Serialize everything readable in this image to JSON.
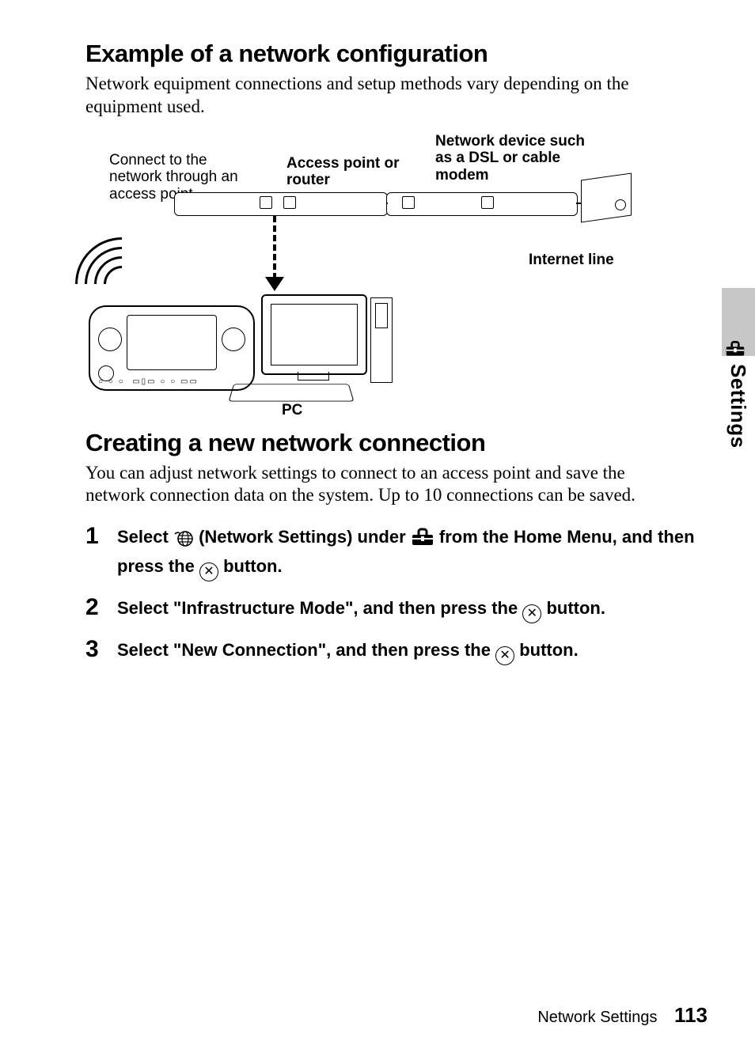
{
  "section1": {
    "heading": "Example of a network configuration",
    "body": "Network equipment connections and setup methods vary depending on the equipment used."
  },
  "diagram": {
    "connect_label": "Connect to the network through an access point.",
    "access_point_label": "Access point or router",
    "modem_label": "Network device such as a DSL or cable modem",
    "internet_label": "Internet line",
    "pc_label": "PC"
  },
  "section2": {
    "heading": "Creating a new network connection",
    "body": "You can adjust network settings to connect to an access point and save the network connection data on the system. Up to 10 connections can be saved."
  },
  "steps": [
    {
      "num": "1",
      "pre": "Select ",
      "net_settings": " (Network Settings) under ",
      "post": " from the Home Menu, and then press the ",
      "tail": " button."
    },
    {
      "num": "2",
      "pre": "Select \"Infrastructure Mode\", and then press the ",
      "tail": " button."
    },
    {
      "num": "3",
      "pre": "Select \"New Connection\", and then press the ",
      "tail": " button."
    }
  ],
  "side": {
    "label": "Settings"
  },
  "footer": {
    "title": "Network Settings",
    "page": "113"
  },
  "chart_data": {
    "type": "diagram",
    "nodes": [
      {
        "id": "psp",
        "label": "PSP handheld",
        "connects_to": "access_point",
        "link": "wireless"
      },
      {
        "id": "access_point",
        "label": "Access point or router",
        "connects_to": "modem",
        "link": "wired"
      },
      {
        "id": "access_point_alt",
        "label": "Access point or router",
        "connects_to": "pc",
        "link": "wired (dashed)"
      },
      {
        "id": "modem",
        "label": "Network device such as a DSL or cable modem",
        "connects_to": "internet",
        "link": "wired"
      },
      {
        "id": "internet",
        "label": "Internet line"
      },
      {
        "id": "pc",
        "label": "PC"
      }
    ]
  }
}
